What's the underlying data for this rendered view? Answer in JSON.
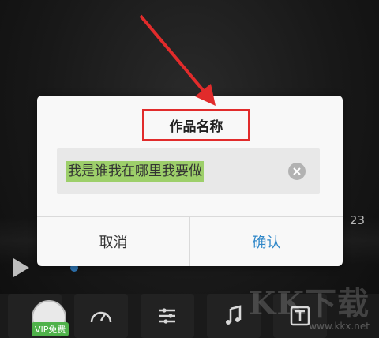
{
  "background": {
    "time_text": "23",
    "vip_label": "VIP免费",
    "watermark": "KK下载",
    "watermark_url": "www.kkx.net"
  },
  "dialog": {
    "title": "作品名称",
    "input_value": "我是谁我在哪里我要做",
    "cancel_label": "取消",
    "confirm_label": "确认"
  },
  "colors": {
    "highlight_box": "#e12b2b",
    "confirm_text": "#2f87c8",
    "selection": "#9dcf6a"
  },
  "icons": [
    "clear-icon",
    "play-icon",
    "speed-icon",
    "settings-icon",
    "music-icon",
    "text-icon",
    "annotation-arrow"
  ]
}
